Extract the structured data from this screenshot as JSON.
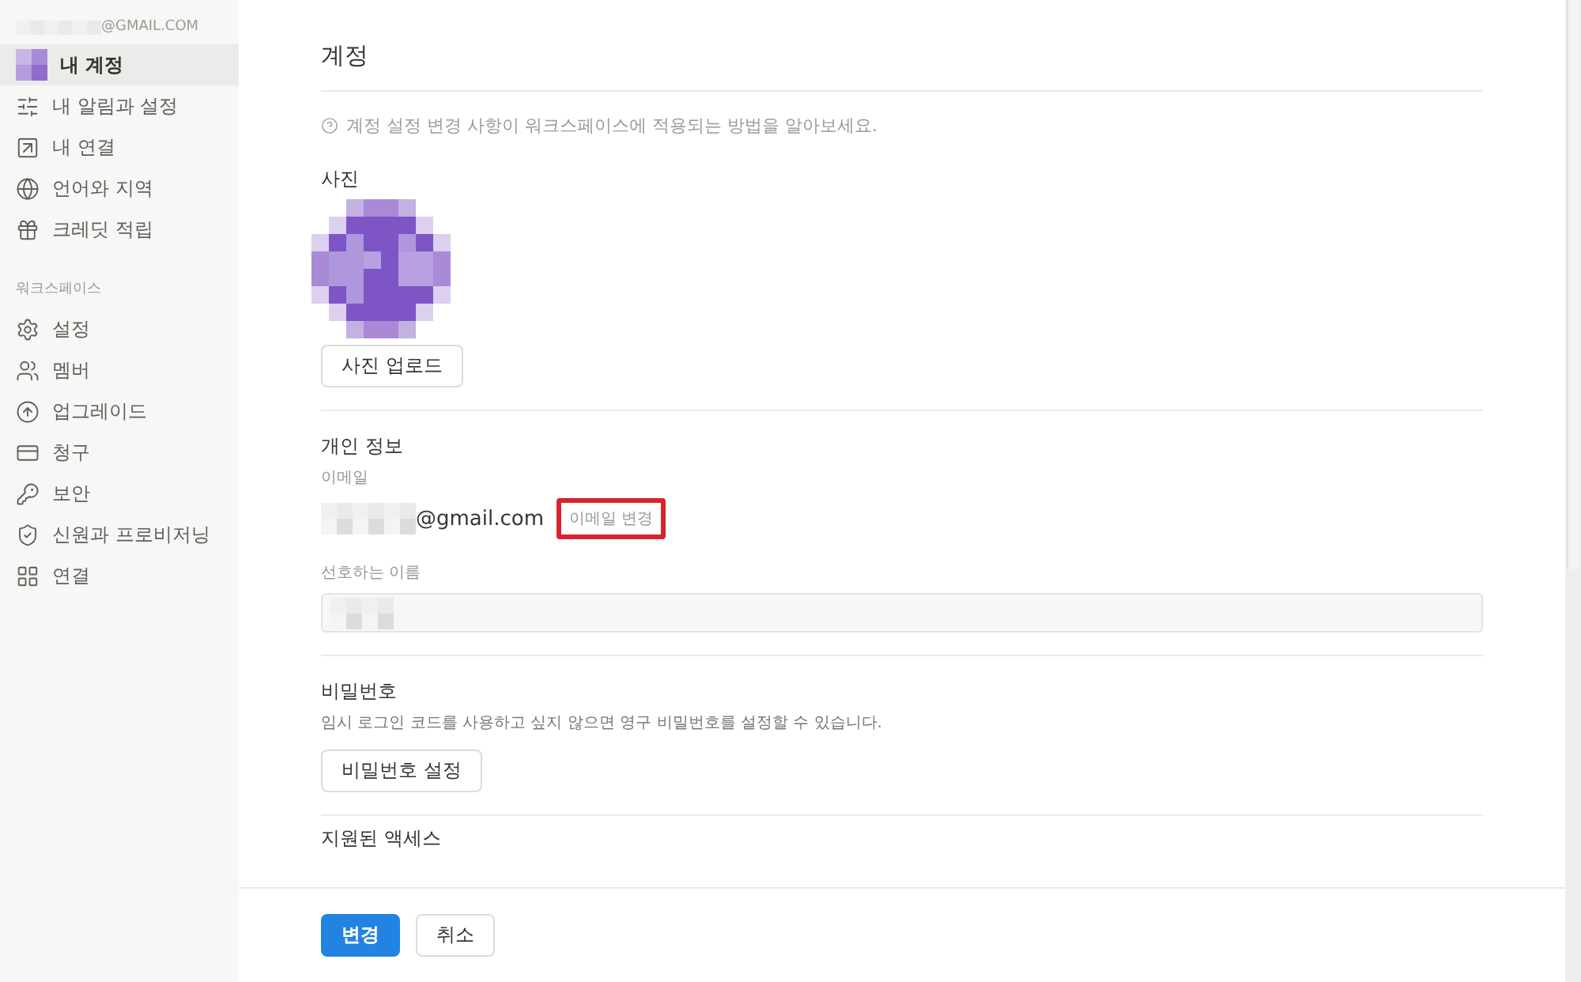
{
  "sidebar": {
    "account_email": "@GMAIL.COM",
    "account_items": [
      {
        "label": "내 계정",
        "selected": true
      },
      {
        "label": "내 알림과 설정",
        "selected": false
      },
      {
        "label": "내 연결",
        "selected": false
      },
      {
        "label": "언어와 지역",
        "selected": false
      },
      {
        "label": "크레딧 적립",
        "selected": false
      }
    ],
    "workspace_label": "워크스페이스",
    "workspace_items": [
      {
        "label": "설정",
        "selected": false
      },
      {
        "label": "멤버",
        "selected": false
      },
      {
        "label": "업그레이드",
        "selected": false
      },
      {
        "label": "청구",
        "selected": false
      },
      {
        "label": "보안",
        "selected": false
      },
      {
        "label": "신원과 프로비저닝",
        "selected": false
      },
      {
        "label": "연결",
        "selected": false
      }
    ]
  },
  "main": {
    "title": "계정",
    "help_text": "계정 설정 변경 사항이 워크스페이스에 적용되는 방법을 알아보세요.",
    "photo": {
      "label": "사진",
      "button": "사진 업로드"
    },
    "personal_info": {
      "heading": "개인 정보",
      "email_label": "이메일",
      "email_domain": "@gmail.com",
      "change_email": {
        "label": "이메일 변경",
        "highlighted": true
      },
      "name_label": "선호하는 이름"
    },
    "password": {
      "heading": "비밀번호",
      "description": "임시 로그인 코드를 사용하고 싶지 않으면 영구 비밀번호를 설정할 수 있습니다.",
      "button": "비밀번호 설정"
    },
    "next_heading": "지원된 액세스"
  },
  "footer": {
    "buttons": [
      {
        "label": "변경",
        "kind": "primary"
      },
      {
        "label": "취소",
        "kind": "secondary"
      }
    ]
  }
}
